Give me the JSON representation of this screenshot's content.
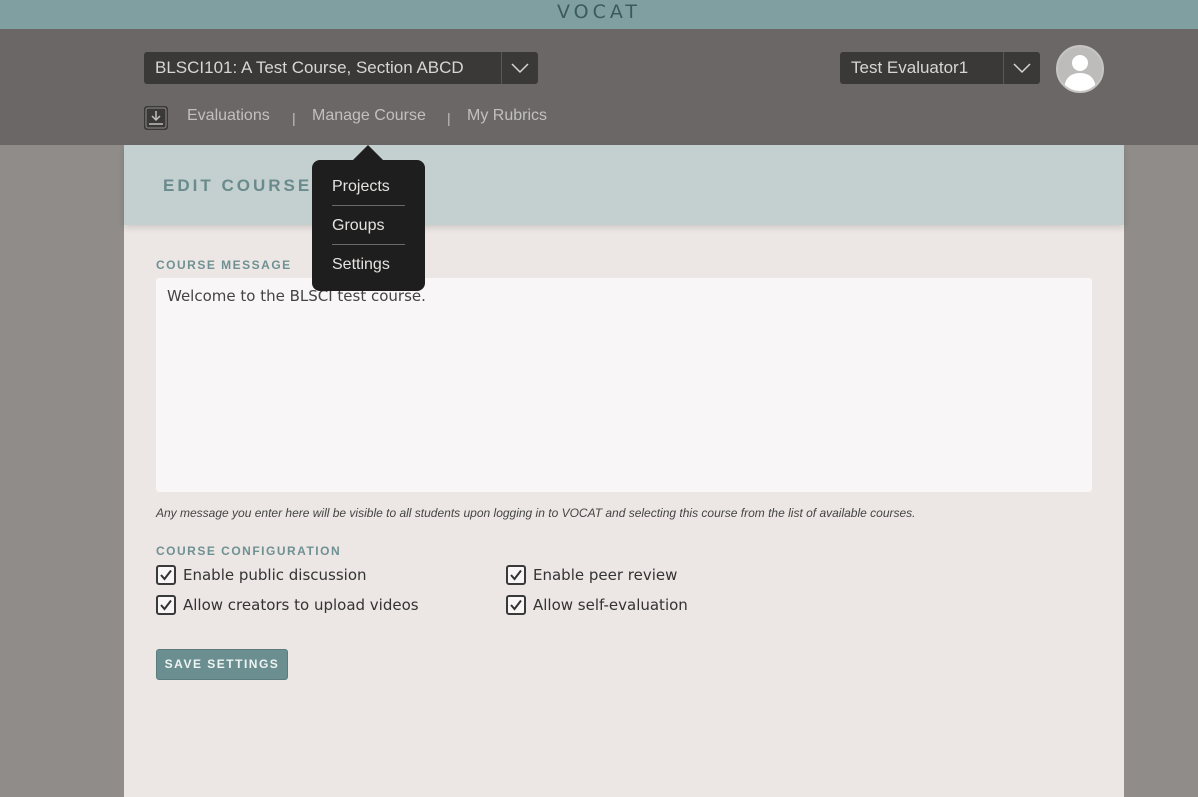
{
  "app": {
    "logo": "VOCAT"
  },
  "header": {
    "course_select": "BLSCI101: A Test Course, Section ABCD",
    "user_select": "Test Evaluator1"
  },
  "nav": {
    "items": [
      {
        "label": "Evaluations"
      },
      {
        "label": "Manage Course"
      },
      {
        "label": "My Rubrics"
      }
    ],
    "separator": "|"
  },
  "dropdown": {
    "items": [
      {
        "label": "Projects"
      },
      {
        "label": "Groups"
      },
      {
        "label": "Settings"
      }
    ]
  },
  "page": {
    "title": "EDIT COURSE S",
    "course_message_label": "COURSE MESSAGE",
    "course_message_value": "Welcome to the BLSCI test course.",
    "help_text": "Any message you enter here will be visible to all students upon logging in to VOCAT and selecting this course from the list of available courses.",
    "config_label": "COURSE CONFIGURATION",
    "options": [
      {
        "label": "Enable public discussion",
        "checked": true
      },
      {
        "label": "Enable peer review",
        "checked": true
      },
      {
        "label": "Allow creators to upload videos",
        "checked": true
      },
      {
        "label": "Allow self-evaluation",
        "checked": true
      }
    ],
    "save_label": "SAVE SETTINGS"
  },
  "colors": {
    "topbar": "#7f9fa0",
    "header": "#6b6767",
    "accent": "#6b8f90",
    "panel": "#ece6e5"
  }
}
